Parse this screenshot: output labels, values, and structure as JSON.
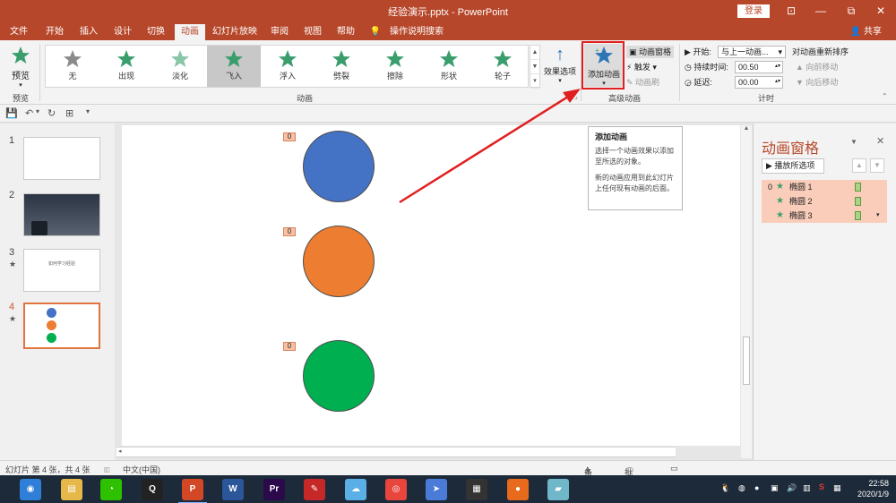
{
  "window": {
    "title": "经验演示.pptx  -  PowerPoint",
    "login_label": "登录",
    "controls": [
      "⊡",
      "—",
      "⧉",
      "✕"
    ]
  },
  "tabs": [
    {
      "label": "文件",
      "active": false
    },
    {
      "label": "开始",
      "active": false
    },
    {
      "label": "插入",
      "active": false
    },
    {
      "label": "设计",
      "active": false
    },
    {
      "label": "切换",
      "active": false
    },
    {
      "label": "动画",
      "active": true
    },
    {
      "label": "幻灯片放映",
      "active": false
    },
    {
      "label": "审阅",
      "active": false
    },
    {
      "label": "视图",
      "active": false
    },
    {
      "label": "帮助",
      "active": false
    },
    {
      "label": "操作说明搜索",
      "active": false
    }
  ],
  "share_label": "共享",
  "ribbon": {
    "preview_label": "预览",
    "preview_group": "预览",
    "animation_group": "动画",
    "advanced_group": "高级动画",
    "timing_group": "计时",
    "animations": [
      {
        "label": "无",
        "color": "#8a8a8a",
        "selected": false
      },
      {
        "label": "出现",
        "color": "#3a9e6c",
        "selected": false
      },
      {
        "label": "淡化",
        "color": "#3a9e6c",
        "selected": false
      },
      {
        "label": "飞入",
        "color": "#3a9e6c",
        "selected": true
      },
      {
        "label": "浮入",
        "color": "#3a9e6c",
        "selected": false
      },
      {
        "label": "劈裂",
        "color": "#3a9e6c",
        "selected": false
      },
      {
        "label": "擦除",
        "color": "#3a9e6c",
        "selected": false
      },
      {
        "label": "形状",
        "color": "#3a9e6c",
        "selected": false
      },
      {
        "label": "轮子",
        "color": "#3a9e6c",
        "selected": false
      }
    ],
    "effect_options": "效果选项",
    "add_animation": "添加动画",
    "animation_pane": "动画窗格",
    "trigger": "触发",
    "animation_painter": "动画刷",
    "start_label": "开始:",
    "start_value": "与上一动画...",
    "duration_label": "持续时间:",
    "duration_value": "00.50",
    "delay_label": "延迟:",
    "delay_value": "00.00",
    "reorder_title": "对动画重新排序",
    "move_earlier": "向前移动",
    "move_later": "向后移动"
  },
  "tooltip": {
    "title": "添加动画",
    "line1": "选择一个动画效果以添加至所选的对象。",
    "line2": "新的动画应用到此幻灯片上任何现有动画的后面。"
  },
  "slides": [
    {
      "num": "1",
      "star": ""
    },
    {
      "num": "2",
      "star": ""
    },
    {
      "num": "3",
      "star": "★",
      "text": "如何学习经验"
    },
    {
      "num": "4",
      "star": "★",
      "active": true
    }
  ],
  "canvas": {
    "badges": [
      "0",
      "0",
      "0"
    ],
    "circle_colors": [
      "#4472c4",
      "#ed7d31",
      "#00b050"
    ]
  },
  "pane": {
    "title": "动画窗格",
    "play_label": "播放所选项",
    "items": [
      {
        "num": "0",
        "name": "椭圆 1"
      },
      {
        "num": "",
        "name": "椭圆 2"
      },
      {
        "num": "",
        "name": "椭圆 3"
      }
    ]
  },
  "status": {
    "slide_info": "幻灯片 第 4 张，共 4 张",
    "language": "中文(中国)",
    "notes": "备注",
    "comments": "批注"
  },
  "clock": {
    "time": "22:58",
    "date": "2020/1/9"
  },
  "taskbar": {
    "icons": [
      {
        "name": "browser-360-icon",
        "color": "#2f7ed8",
        "glyph": "◉"
      },
      {
        "name": "file-explorer-icon",
        "color": "#e6b84a",
        "glyph": "▤"
      },
      {
        "name": "wechat-icon",
        "color": "#2dc100",
        "glyph": "◔"
      },
      {
        "name": "qq-icon",
        "color": "#222222",
        "glyph": "Q"
      },
      {
        "name": "powerpoint-icon",
        "color": "#d24726",
        "glyph": "P"
      },
      {
        "name": "word-icon",
        "color": "#2b579a",
        "glyph": "W"
      },
      {
        "name": "premiere-icon",
        "color": "#2a0a4a",
        "glyph": "Pr"
      },
      {
        "name": "paint-icon",
        "color": "#c62828",
        "glyph": "✎"
      },
      {
        "name": "cloud-icon",
        "color": "#5ab0e6",
        "glyph": "☁"
      },
      {
        "name": "chrome-icon",
        "color": "#e8453c",
        "glyph": "◎"
      },
      {
        "name": "feishu-icon",
        "color": "#4a7bd6",
        "glyph": "➤"
      },
      {
        "name": "video-editor-icon",
        "color": "#333333",
        "glyph": "▦"
      },
      {
        "name": "ball-app-icon",
        "color": "#e86a1c",
        "glyph": "●"
      },
      {
        "name": "notes-app-icon",
        "color": "#6fb7c9",
        "glyph": "▰"
      }
    ]
  }
}
